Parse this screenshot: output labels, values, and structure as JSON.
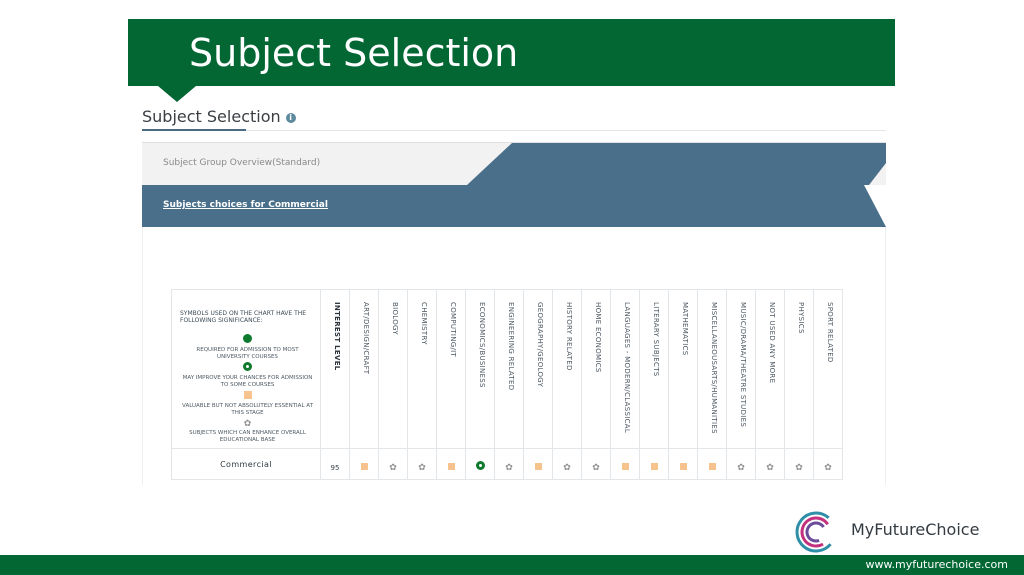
{
  "slide": {
    "title": "Subject Selection",
    "colors": {
      "brand_green": "#036734",
      "panel_blue": "#4a6f8a"
    }
  },
  "panel": {
    "heading": "Subject Selection",
    "info_icon": "info-icon",
    "group_overview_label": "Subject Group Overview(Standard)",
    "subjects_choices_link": "Subjects choices for Commercial"
  },
  "legend": {
    "header": "SYMBOLS USED ON THE CHART HAVE THE FOLLOWING SIGNIFICANCE:",
    "items": [
      {
        "symbol": "solid-green-dot-icon",
        "text": "REQUIRED FOR ADMISSION TO MOST UNIVERSITY COURSES"
      },
      {
        "symbol": "ringed-green-dot-icon",
        "text": "MAY IMPROVE YOUR CHANCES FOR ADMISSION TO SOME COURSES"
      },
      {
        "symbol": "orange-square-icon",
        "text": "VALUABLE BUT NOT ABSOLUTELY ESSENTIAL AT THIS STAGE"
      },
      {
        "symbol": "flower-icon",
        "text": "SUBJECTS WHICH CAN ENHANCE OVERALL EDUCATIONAL BASE"
      }
    ]
  },
  "table": {
    "columns": [
      "INTEREST LEVEL",
      "ART/DESIGN/CRAFT",
      "BIOLOGY",
      "CHEMISTRY",
      "COMPUTING/IT",
      "ECONOMICS/BUSINESS",
      "ENGINEERING RELATED",
      "GEOGRAPHY/GEOLOGY",
      "HISTORY RELATED",
      "HOME ECONOMICS",
      "LANGUAGES - MODERN/CLASSICAL",
      "LITERARY SUBJECTS",
      "MATHEMATICS",
      "MISCELLANEOUSARTS/HUMANITIES",
      "MUSIC/DRAMA/THEATRE STUDIES",
      "NOT USED ANY MORE",
      "PHYSICS",
      "SPORT RELATED"
    ],
    "rows": [
      {
        "name": "Commercial",
        "interest_level": "95",
        "cells": [
          "square",
          "flower",
          "flower",
          "square",
          "ring",
          "flower",
          "square",
          "flower",
          "flower",
          "square",
          "square",
          "square",
          "square",
          "flower",
          "flower",
          "flower",
          "flower"
        ]
      }
    ]
  },
  "branding": {
    "logo_text": "MyFutureChoice",
    "url": "www.myfuturechoice.com"
  }
}
